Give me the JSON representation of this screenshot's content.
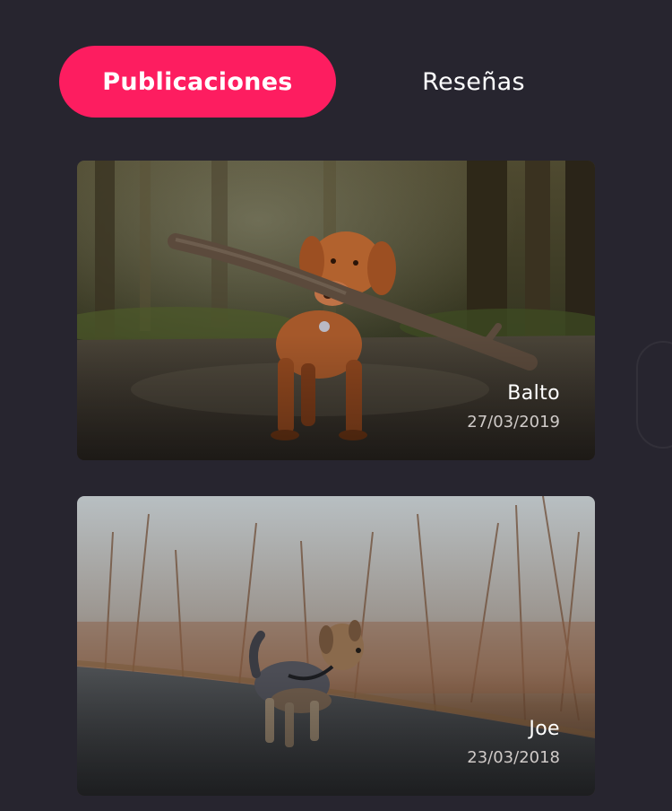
{
  "tabs": {
    "active_label": "Publicaciones",
    "inactive_label": "Reseñas"
  },
  "posts": [
    {
      "name": "Balto",
      "date": "27/03/2019"
    },
    {
      "name": "Joe",
      "date": "23/03/2018"
    }
  ],
  "colors": {
    "background": "#27252f",
    "accent": "#fd1d60",
    "text": "#ffffff",
    "date_text": "#cfcac8"
  }
}
